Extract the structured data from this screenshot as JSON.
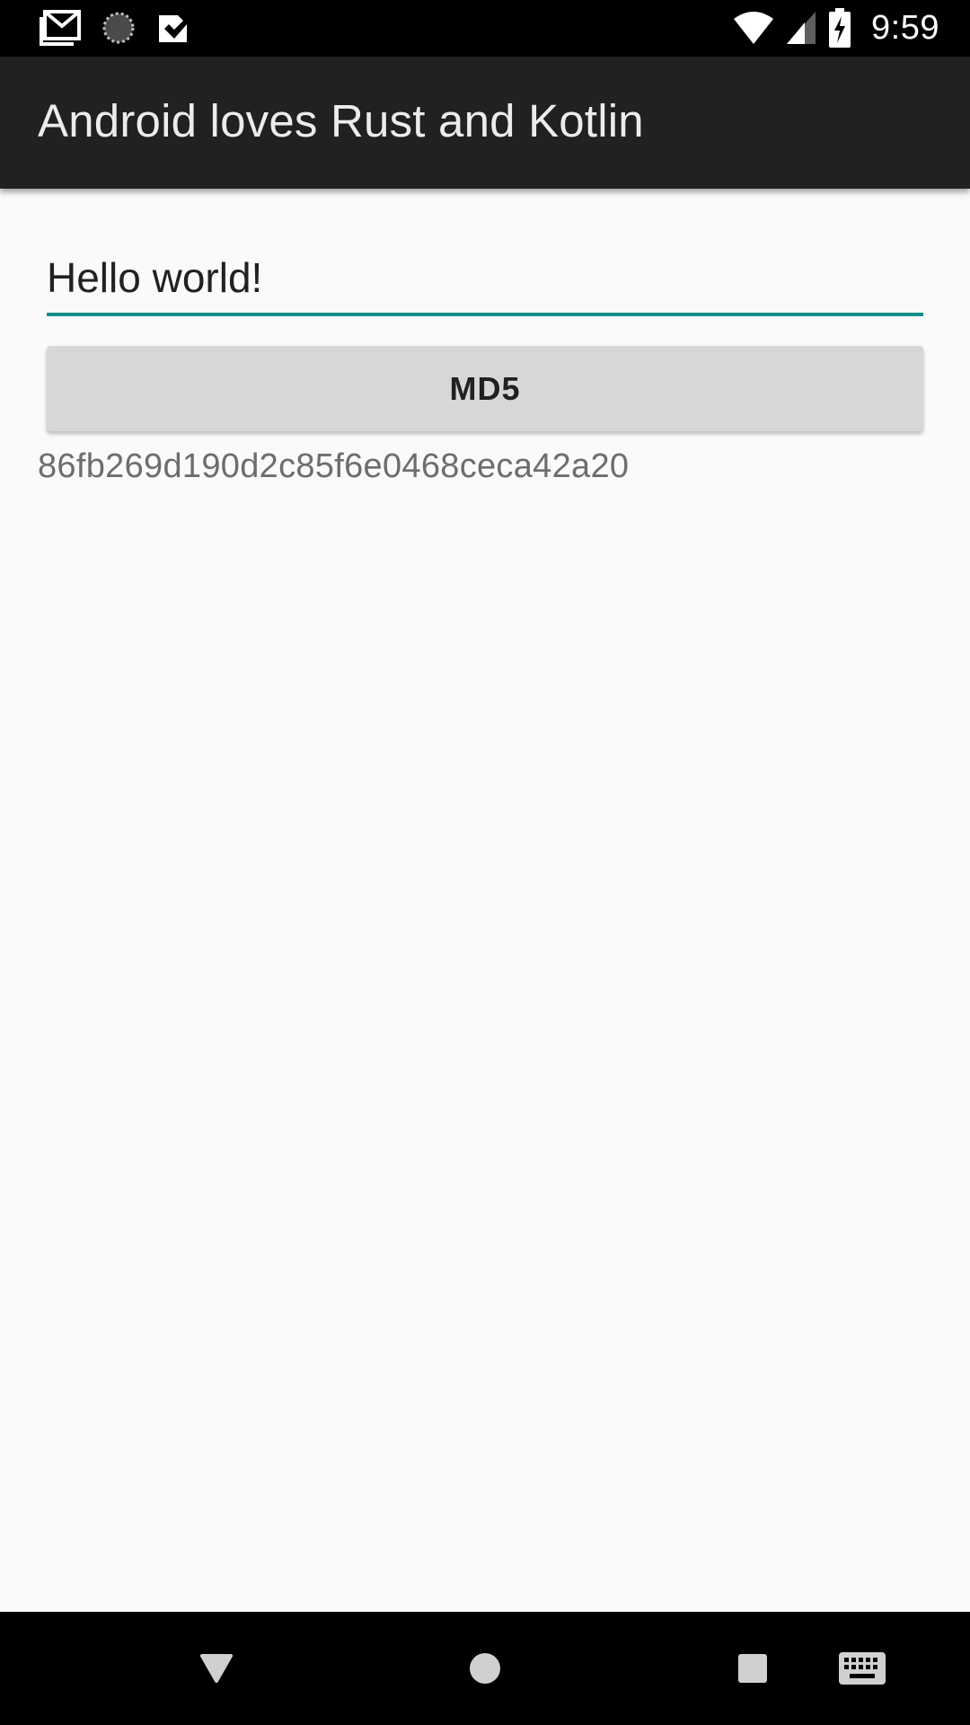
{
  "status_bar": {
    "time": "9:59",
    "left_icons": [
      "gmail-icon",
      "sync-icon",
      "checkmark-app-icon"
    ],
    "right_icons": [
      "wifi-icon",
      "signal-icon",
      "battery-charging-icon"
    ]
  },
  "app_bar": {
    "title": "Android loves Rust and Kotlin",
    "background": "#212121"
  },
  "main": {
    "input_value": "Hello world!",
    "input_underline_color": "#128f86",
    "button_label": "MD5",
    "hash_output": "86fb269d190d2c85f6e0468ceca42a20"
  },
  "nav_bar": {
    "icons": [
      "back-icon",
      "home-icon",
      "recents-icon",
      "keyboard-icon"
    ]
  }
}
